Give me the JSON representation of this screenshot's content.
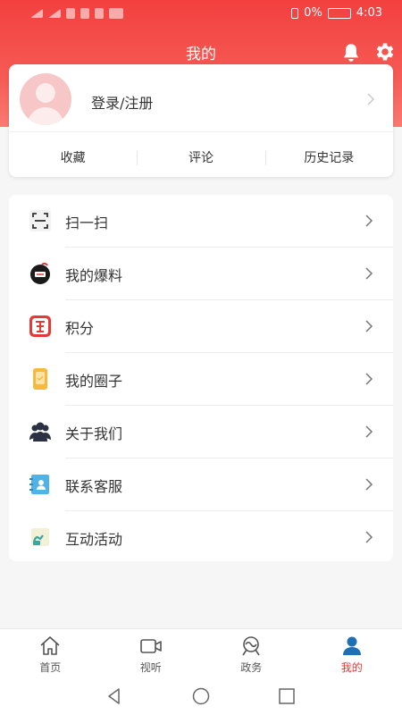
{
  "status_bar": {
    "time": "4:03",
    "battery": "0%"
  },
  "header": {
    "title": "我的"
  },
  "profile": {
    "login_label": "登录/注册"
  },
  "quick_links": [
    {
      "label": "收藏"
    },
    {
      "label": "评论"
    },
    {
      "label": "历史记录"
    }
  ],
  "menu": [
    {
      "label": "扫一扫",
      "icon": "scan-icon"
    },
    {
      "label": "我的爆料",
      "icon": "baoliao-icon"
    },
    {
      "label": "积分",
      "icon": "points-icon"
    },
    {
      "label": "我的圈子",
      "icon": "circle-icon"
    },
    {
      "label": "关于我们",
      "icon": "people-icon"
    },
    {
      "label": "联系客服",
      "icon": "contact-icon"
    },
    {
      "label": "互动活动",
      "icon": "activity-icon"
    }
  ],
  "tabs": [
    {
      "label": "首页",
      "icon": "home-icon"
    },
    {
      "label": "视听",
      "icon": "video-icon"
    },
    {
      "label": "政务",
      "icon": "government-icon"
    },
    {
      "label": "我的",
      "icon": "user-icon",
      "active": true
    }
  ],
  "colors": {
    "brand_red": "#f2403f",
    "active_tab": "#e53935"
  }
}
